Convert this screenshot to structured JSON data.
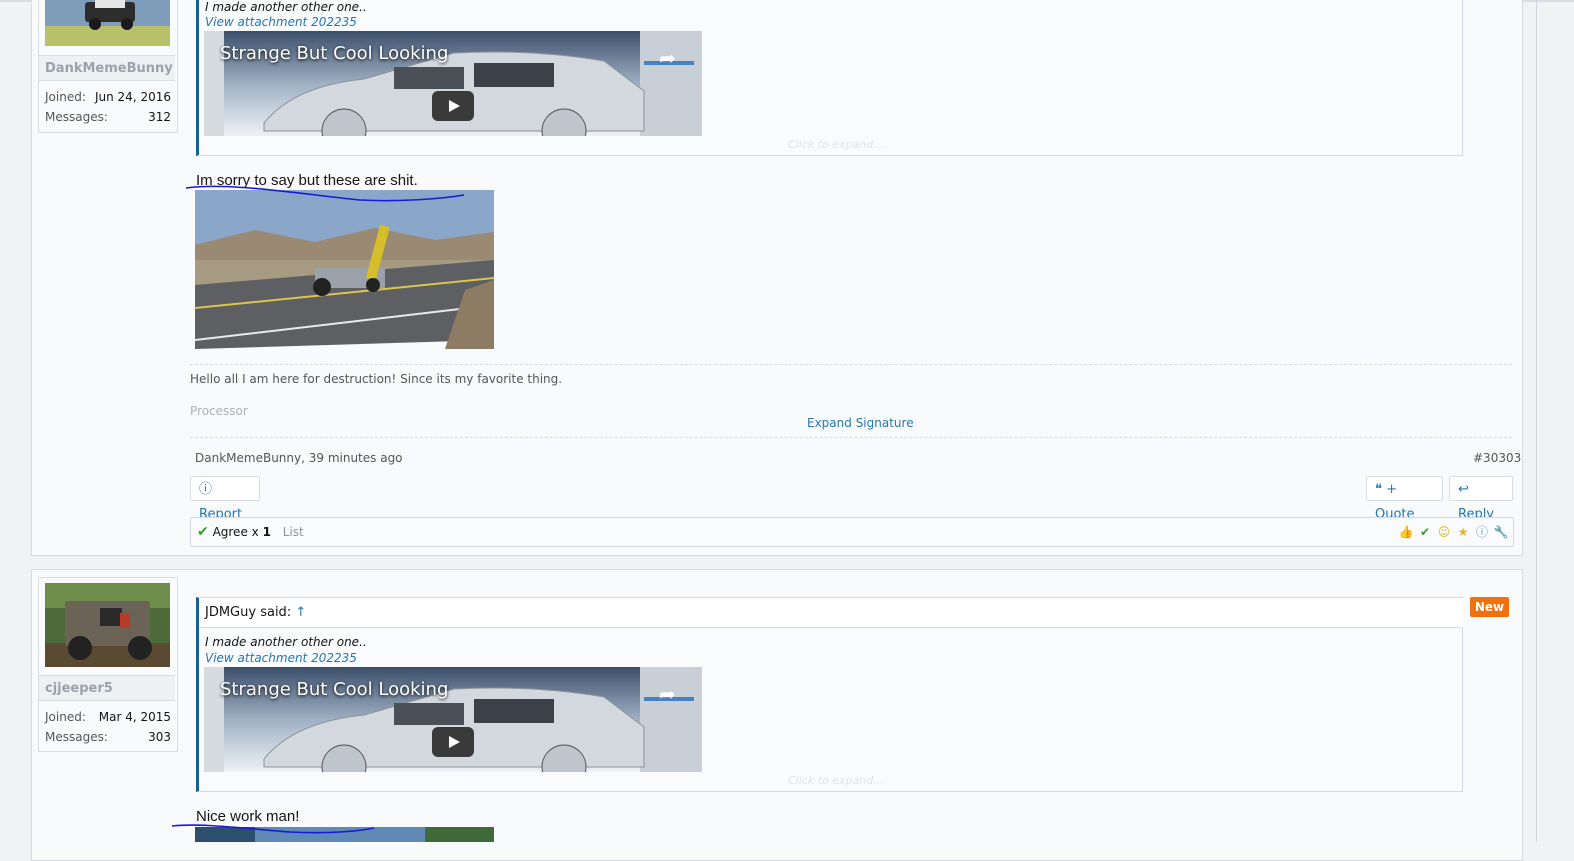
{
  "post1": {
    "username": "DankMemeBunny",
    "joined_label": "Joined:",
    "joined_value": "Jun 24, 2016",
    "messages_label": "Messages:",
    "messages_value": "312",
    "quote_text": "I made another other one..",
    "quote_attachment_link": "View attachment 202235",
    "video_title": "Strange But Cool Looking",
    "click_to_expand": "Click to expand...",
    "message": "Im sorry to say but these are shit.",
    "signature_text": "Hello all I am here for destruction! Since its my favorite thing.",
    "signature_faint": "Processor",
    "expand_signature": "Expand Signature",
    "meta_author_time": "DankMemeBunny, 39 minutes ago",
    "permalink": "#30303",
    "report_label": "Report",
    "quote_label": "+ Quote",
    "reply_label": "Reply",
    "agree_label": "Agree x ",
    "agree_count": "1",
    "list_label": "List"
  },
  "post2": {
    "username": "cjjeeper5",
    "joined_label": "Joined:",
    "joined_value": "Mar 4, 2015",
    "messages_label": "Messages:",
    "messages_value": "303",
    "quote_author": "JDMGuy said:",
    "quote_arrow": "↑",
    "quote_text": "I made another other one..",
    "quote_attachment_link": "View attachment 202235",
    "video_title": "Strange But Cool Looking",
    "click_to_expand": "Click to expand...",
    "message": "Nice work man!",
    "new_badge": "New"
  },
  "icons": [
    "report-info-icon",
    "quote-icon",
    "reply-icon",
    "agree-check-icon",
    "thumbs-up-icon",
    "check-icon",
    "funny-icon",
    "award-icon",
    "info-icon",
    "wrench-icon",
    "play-icon",
    "share-icon"
  ],
  "colors": {
    "link": "#2577b1",
    "new_badge": "#f0710d",
    "quote_border": "#176093",
    "annotation_ink": "#1a1ad8"
  }
}
